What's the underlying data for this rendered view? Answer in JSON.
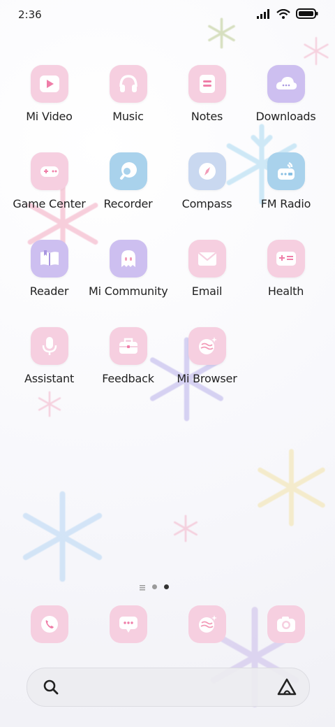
{
  "status": {
    "time": "2:36"
  },
  "apps": [
    {
      "id": "mi-video",
      "label": "Mi Video",
      "icon": "play-icon"
    },
    {
      "id": "music",
      "label": "Music",
      "icon": "headphones-icon"
    },
    {
      "id": "notes",
      "label": "Notes",
      "icon": "notes-icon"
    },
    {
      "id": "downloads",
      "label": "Downloads",
      "icon": "cloud-icon"
    },
    {
      "id": "game-center",
      "label": "Game Center",
      "icon": "gamepad-icon"
    },
    {
      "id": "recorder",
      "label": "Recorder",
      "icon": "recorder-icon"
    },
    {
      "id": "compass",
      "label": "Compass",
      "icon": "compass-icon"
    },
    {
      "id": "fm-radio",
      "label": "FM Radio",
      "icon": "radio-icon"
    },
    {
      "id": "reader",
      "label": "Reader",
      "icon": "book-icon"
    },
    {
      "id": "mi-community",
      "label": "Mi Community",
      "icon": "ghost-icon"
    },
    {
      "id": "email",
      "label": "Email",
      "icon": "mail-icon"
    },
    {
      "id": "health",
      "label": "Health",
      "icon": "health-card-icon"
    },
    {
      "id": "assistant",
      "label": "Assistant",
      "icon": "microphone-icon"
    },
    {
      "id": "feedback",
      "label": "Feedback",
      "icon": "toolbox-icon"
    },
    {
      "id": "mi-browser",
      "label": "Mi Browser",
      "icon": "browser-globe-icon"
    }
  ],
  "dock": [
    {
      "id": "phone",
      "icon": "phone-icon"
    },
    {
      "id": "messages",
      "icon": "message-icon"
    },
    {
      "id": "browser",
      "icon": "browser-globe-icon"
    },
    {
      "id": "camera",
      "icon": "camera-icon"
    }
  ],
  "pager": {
    "pages": 2,
    "current": 2
  },
  "colors": {
    "pink": "#f6cfe0",
    "lavender": "#cdbff0",
    "blue": "#a9d2ec"
  }
}
